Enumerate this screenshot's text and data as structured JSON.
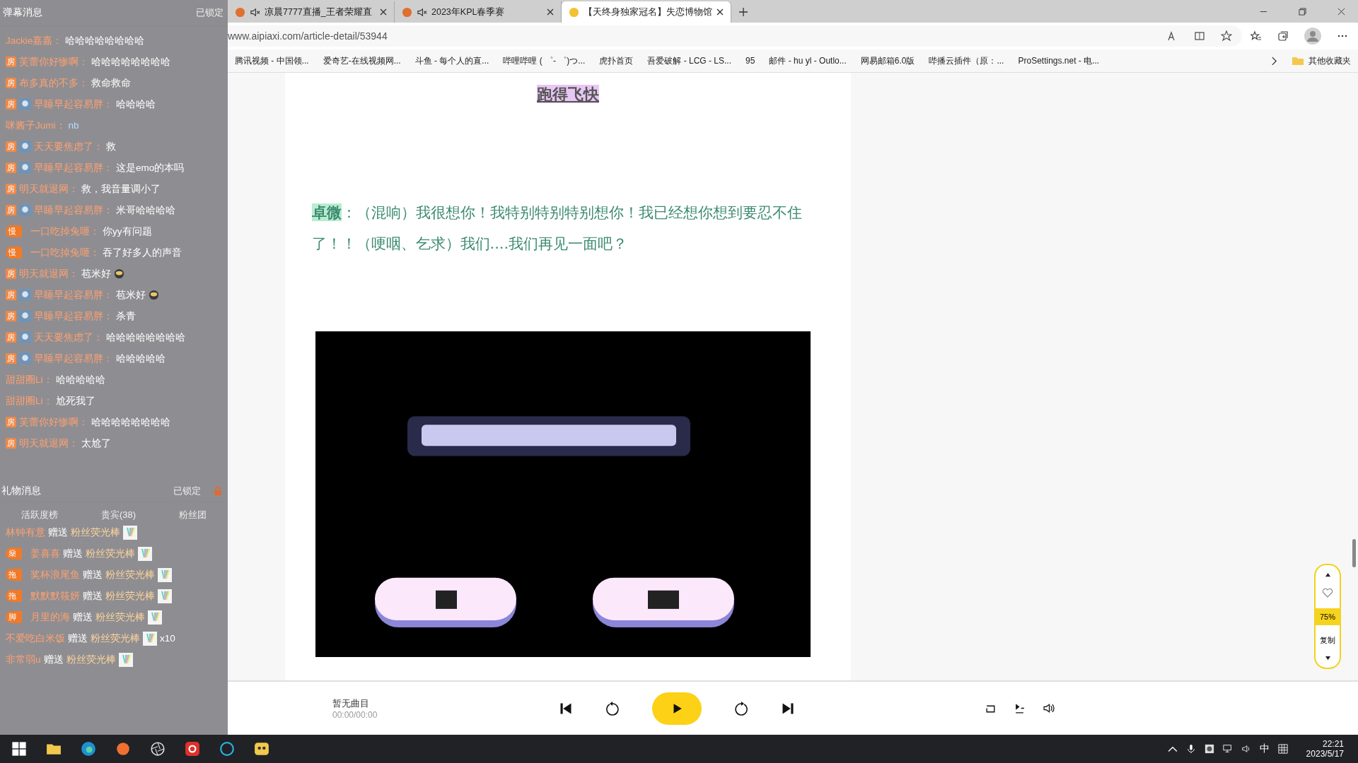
{
  "chat_panel": {
    "title": "弹幕消息",
    "lock_label": "已锁定",
    "messages": [
      {
        "user": "Jackie嘉嘉：",
        "text": "哈哈哈哈哈哈哈哈"
      },
      {
        "user": "芙蕾你好惨啊：",
        "text": "哈哈哈哈哈哈哈哈",
        "badge": {
          "kind": "room",
          "text": "房"
        }
      },
      {
        "user": "布多真的不多：",
        "text": "救命救命",
        "badge": {
          "kind": "room",
          "text": "房"
        }
      },
      {
        "user": "早睡早起容易胖：",
        "text": "哈哈哈哈",
        "badge": {
          "kind": "room",
          "text": "房"
        },
        "avatar": true
      },
      {
        "user": "咪酱子Jumi：",
        "text": "nb",
        "accent": true
      },
      {
        "user": "天天要焦虑了：",
        "text": "救",
        "badge": {
          "kind": "room",
          "text": "房"
        },
        "avatar": true
      },
      {
        "user": "早睡早起容易胖：",
        "text": "这是emo的本吗",
        "badge": {
          "kind": "room",
          "text": "房"
        },
        "avatar": true
      },
      {
        "user": "明天就退网：",
        "text": "救，我音量调小了",
        "badge": {
          "kind": "room",
          "text": "房"
        }
      },
      {
        "user": "早睡早起容易胖：",
        "text": "米哥哈哈哈哈",
        "badge": {
          "kind": "room",
          "text": "房"
        },
        "avatar": true
      },
      {
        "user": "一口吃掉兔咂：",
        "text": "你yy有问题",
        "badge": {
          "kind": "medal",
          "text": "慢"
        }
      },
      {
        "user": "一口吃掉兔咂：",
        "text": "吞了好多人的声音",
        "badge": {
          "kind": "medal",
          "text": "慢"
        }
      },
      {
        "user": "明天就退网：",
        "text": "苞米好",
        "badge": {
          "kind": "room",
          "text": "房"
        },
        "emoji": true
      },
      {
        "user": "早睡早起容易胖：",
        "text": "苞米好",
        "badge": {
          "kind": "room",
          "text": "房"
        },
        "avatar": true,
        "emoji": true
      },
      {
        "user": "早睡早起容易胖：",
        "text": "杀青",
        "badge": {
          "kind": "room",
          "text": "房"
        },
        "avatar": true
      },
      {
        "user": "天天要焦虑了：",
        "text": "哈哈哈哈哈哈哈哈",
        "badge": {
          "kind": "room",
          "text": "房"
        },
        "avatar": true
      },
      {
        "user": "早睡早起容易胖：",
        "text": "哈哈哈哈哈",
        "badge": {
          "kind": "room",
          "text": "房"
        },
        "avatar": true
      },
      {
        "user": "甜甜圈Li：",
        "text": "哈哈哈哈哈"
      },
      {
        "user": "甜甜圈Li：",
        "text": "尬死我了"
      },
      {
        "user": "芙蕾你好惨啊：",
        "text": "哈哈哈哈哈哈哈哈",
        "badge": {
          "kind": "room",
          "text": "房"
        }
      },
      {
        "user": "明天就退网：",
        "text": "太尬了",
        "badge": {
          "kind": "room",
          "text": "房"
        }
      }
    ],
    "gift_title": "礼物消息",
    "gift_lock_label": "已锁定",
    "gift_tabs": [
      {
        "label": "活跃度榜"
      },
      {
        "label": "贵宾(38)"
      },
      {
        "label": "粉丝团"
      }
    ],
    "gifts": [
      {
        "user": "林钟有意",
        "verb": "赠送",
        "gift": "粉丝荧光棒"
      },
      {
        "user": "姜喜喜",
        "medal": "燊",
        "verb": "赠送",
        "gift": "粉丝荧光棒"
      },
      {
        "user": "奖杯浪尾鱼",
        "medal": "拖",
        "verb": "赠送",
        "gift": "粉丝荧光棒"
      },
      {
        "user": "默默默筱妍",
        "medal": "拖",
        "verb": "赠送",
        "gift": "粉丝荧光棒"
      },
      {
        "user": "月里的海",
        "medal": "脚",
        "verb": "赠送",
        "gift": "粉丝荧光棒"
      },
      {
        "user": "不爱吃白米饭",
        "verb": "赠送",
        "gift": "粉丝荧光棒",
        "count": "x10"
      },
      {
        "user": "非常弱u",
        "verb": "赠送",
        "gift": "粉丝荧光棒"
      }
    ]
  },
  "browser": {
    "tabs": [
      {
        "title": "凉晨7777直播_王者荣耀直",
        "muted": true,
        "selected": false
      },
      {
        "title": "2023年KPL春季赛",
        "muted": true,
        "selected": false
      },
      {
        "title": "【天终身独家冠名】失恋博物馆",
        "muted": false,
        "selected": true
      }
    ],
    "address": "www.aipiaxi.com/article-detail/53944",
    "bookmarks": [
      "腾讯视频 - 中国领...",
      "爱奇艺-在线视频网...",
      "斗鱼 - 每个人的直...",
      "哔哩哔哩 ( ゜- ゜)つ...",
      "虎扑首页",
      "吾爱破解 - LCG - LS...",
      "95",
      "邮件 - hu yl - Outlo...",
      "网易邮箱6.0版",
      "哔播云插件（原：...",
      "ProSettings.net - 电..."
    ],
    "other_bookmarks": "其他收藏夹"
  },
  "article": {
    "title": "跑得飞快",
    "paragraph": {
      "speaker": "卓微",
      "text": "：（混响）我很想你！我特别特别特别想你！我已经想你想到要忍不住了！！（哽咽、乞求）我们....我们再见一面吧？"
    }
  },
  "side_widget": {
    "zoom": "75%",
    "copy": "复制"
  },
  "player": {
    "track": "暂无曲目",
    "time": "00:00/00:00"
  },
  "taskbar": {
    "ime": "中",
    "time": "22:21",
    "date": "2023/5/17"
  }
}
